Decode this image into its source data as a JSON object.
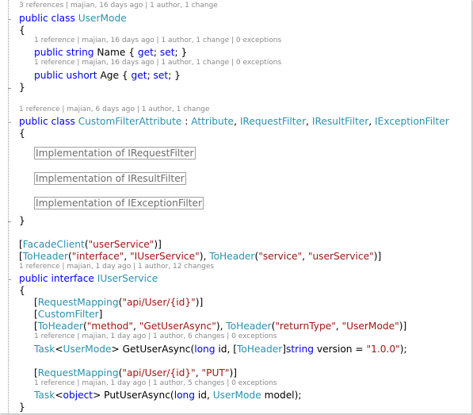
{
  "lines": [
    {
      "kind": "lens",
      "indent": 0,
      "text": "3 references | majian, 16 days ago | 1 author, 1 change"
    },
    {
      "kind": "code",
      "indent": 0,
      "tokens": [
        {
          "t": "public",
          "c": "kw"
        },
        {
          "t": " "
        },
        {
          "t": "class",
          "c": "kw"
        },
        {
          "t": " "
        },
        {
          "t": "UserMode",
          "c": "ty"
        }
      ]
    },
    {
      "kind": "code",
      "indent": 0,
      "tokens": [
        {
          "t": "{"
        }
      ]
    },
    {
      "kind": "lens",
      "indent": 1,
      "text": "1 reference | majian, 16 days ago | 1 author, 1 change | 0 exceptions"
    },
    {
      "kind": "code",
      "indent": 1,
      "tokens": [
        {
          "t": "public",
          "c": "kw"
        },
        {
          "t": " "
        },
        {
          "t": "string",
          "c": "kw"
        },
        {
          "t": " Name { "
        },
        {
          "t": "get",
          "c": "kw"
        },
        {
          "t": "; "
        },
        {
          "t": "set",
          "c": "kw"
        },
        {
          "t": "; }"
        }
      ]
    },
    {
      "kind": "lens",
      "indent": 1,
      "text": "1 reference | majian, 16 days ago | 1 author, 1 change | 0 exceptions"
    },
    {
      "kind": "code",
      "indent": 1,
      "tokens": [
        {
          "t": "public",
          "c": "kw"
        },
        {
          "t": " "
        },
        {
          "t": "ushort",
          "c": "kw"
        },
        {
          "t": " Age { "
        },
        {
          "t": "get",
          "c": "kw"
        },
        {
          "t": "; "
        },
        {
          "t": "set",
          "c": "kw"
        },
        {
          "t": "; }"
        }
      ]
    },
    {
      "kind": "code",
      "indent": 0,
      "tokens": [
        {
          "t": "}"
        }
      ]
    },
    {
      "kind": "gap"
    },
    {
      "kind": "lens",
      "indent": 0,
      "text": "1 reference | majian, 6 days ago | 1 author, 1 change"
    },
    {
      "kind": "code",
      "indent": 0,
      "tokens": [
        {
          "t": "public",
          "c": "kw"
        },
        {
          "t": " "
        },
        {
          "t": "class",
          "c": "kw"
        },
        {
          "t": " "
        },
        {
          "t": "CustomFilterAttribute",
          "c": "ty"
        },
        {
          "t": " : "
        },
        {
          "t": "Attribute",
          "c": "ty"
        },
        {
          "t": ", "
        },
        {
          "t": "IRequestFilter",
          "c": "ty"
        },
        {
          "t": ", "
        },
        {
          "t": "IResultFilter",
          "c": "ty"
        },
        {
          "t": ", "
        },
        {
          "t": "IExceptionFilter",
          "c": "ty"
        }
      ]
    },
    {
      "kind": "code",
      "indent": 0,
      "tokens": [
        {
          "t": "{"
        }
      ]
    },
    {
      "kind": "collapsed",
      "indent": 1,
      "text": "Implementation of IRequestFilter"
    },
    {
      "kind": "collapsed",
      "indent": 1,
      "text": "Implementation of IResultFilter"
    },
    {
      "kind": "collapsed",
      "indent": 1,
      "text": "Implementation of IExceptionFilter"
    },
    {
      "kind": "code",
      "indent": 0,
      "tokens": [
        {
          "t": "}"
        }
      ]
    },
    {
      "kind": "gap"
    },
    {
      "kind": "code",
      "indent": 0,
      "tokens": [
        {
          "t": "["
        },
        {
          "t": "FacadeClient",
          "c": "ty"
        },
        {
          "t": "("
        },
        {
          "t": "\"userService\"",
          "c": "st"
        },
        {
          "t": ")]"
        }
      ]
    },
    {
      "kind": "code",
      "indent": 0,
      "tokens": [
        {
          "t": "["
        },
        {
          "t": "ToHeader",
          "c": "ty"
        },
        {
          "t": "("
        },
        {
          "t": "\"interface\"",
          "c": "st"
        },
        {
          "t": ", "
        },
        {
          "t": "\"IUserService\"",
          "c": "st"
        },
        {
          "t": "), "
        },
        {
          "t": "ToHeader",
          "c": "ty"
        },
        {
          "t": "("
        },
        {
          "t": "\"service\"",
          "c": "st"
        },
        {
          "t": ", "
        },
        {
          "t": "\"userService\"",
          "c": "st"
        },
        {
          "t": ")]"
        }
      ]
    },
    {
      "kind": "lens",
      "indent": 0,
      "text": "1 reference | majian, 1 day ago | 1 author, 12 changes"
    },
    {
      "kind": "code",
      "indent": 0,
      "tokens": [
        {
          "t": "public",
          "c": "kw"
        },
        {
          "t": " "
        },
        {
          "t": "interface",
          "c": "kw"
        },
        {
          "t": " "
        },
        {
          "t": "IUserService",
          "c": "ty"
        }
      ]
    },
    {
      "kind": "code",
      "indent": 0,
      "tokens": [
        {
          "t": "{"
        }
      ]
    },
    {
      "kind": "code",
      "indent": 1,
      "tokens": [
        {
          "t": "["
        },
        {
          "t": "RequestMapping",
          "c": "ty"
        },
        {
          "t": "("
        },
        {
          "t": "\"api/User/{id}\"",
          "c": "st"
        },
        {
          "t": ")]"
        }
      ]
    },
    {
      "kind": "code",
      "indent": 1,
      "tokens": [
        {
          "t": "["
        },
        {
          "t": "CustomFilter",
          "c": "ty"
        },
        {
          "t": "]"
        }
      ]
    },
    {
      "kind": "code",
      "indent": 1,
      "tokens": [
        {
          "t": "["
        },
        {
          "t": "ToHeader",
          "c": "ty"
        },
        {
          "t": "("
        },
        {
          "t": "\"method\"",
          "c": "st"
        },
        {
          "t": ", "
        },
        {
          "t": "\"GetUserAsync\"",
          "c": "st"
        },
        {
          "t": "), "
        },
        {
          "t": "ToHeader",
          "c": "ty"
        },
        {
          "t": "("
        },
        {
          "t": "\"returnType\"",
          "c": "st"
        },
        {
          "t": ", "
        },
        {
          "t": "\"UserMode\"",
          "c": "st"
        },
        {
          "t": ")]"
        }
      ]
    },
    {
      "kind": "lens",
      "indent": 1,
      "text": "1 reference | majian, 1 day ago | 1 author, 6 changes | 0 exceptions"
    },
    {
      "kind": "code",
      "indent": 1,
      "tokens": [
        {
          "t": "Task",
          "c": "ty"
        },
        {
          "t": "<"
        },
        {
          "t": "UserMode",
          "c": "ty"
        },
        {
          "t": "> GetUserAsync("
        },
        {
          "t": "long",
          "c": "kw"
        },
        {
          "t": " id, ["
        },
        {
          "t": "ToHeader",
          "c": "ty"
        },
        {
          "t": "]"
        },
        {
          "t": "string",
          "c": "kw"
        },
        {
          "t": " version = "
        },
        {
          "t": "\"1.0.0\"",
          "c": "st"
        },
        {
          "t": ");"
        }
      ]
    },
    {
      "kind": "gap"
    },
    {
      "kind": "code",
      "indent": 1,
      "tokens": [
        {
          "t": "["
        },
        {
          "t": "RequestMapping",
          "c": "ty"
        },
        {
          "t": "("
        },
        {
          "t": "\"api/User/{id}\"",
          "c": "st"
        },
        {
          "t": ", "
        },
        {
          "t": "\"PUT\"",
          "c": "st"
        },
        {
          "t": ")]"
        }
      ]
    },
    {
      "kind": "lens",
      "indent": 1,
      "text": "1 reference | majian, 1 day ago | 1 author, 5 changes | 0 exceptions"
    },
    {
      "kind": "code",
      "indent": 1,
      "tokens": [
        {
          "t": "Task",
          "c": "ty"
        },
        {
          "t": "<"
        },
        {
          "t": "object",
          "c": "kw"
        },
        {
          "t": "> PutUserAsync("
        },
        {
          "t": "long",
          "c": "kw"
        },
        {
          "t": " id, "
        },
        {
          "t": "UserMode",
          "c": "ty"
        },
        {
          "t": " model);"
        }
      ]
    },
    {
      "kind": "code",
      "indent": 0,
      "tokens": [
        {
          "t": "}"
        }
      ]
    }
  ],
  "colors": {
    "keyword": "#0000ff",
    "type": "#2b91af",
    "string": "#a31515",
    "codelens": "#8a8a8a",
    "collapsed_border": "#a0a0a0"
  }
}
